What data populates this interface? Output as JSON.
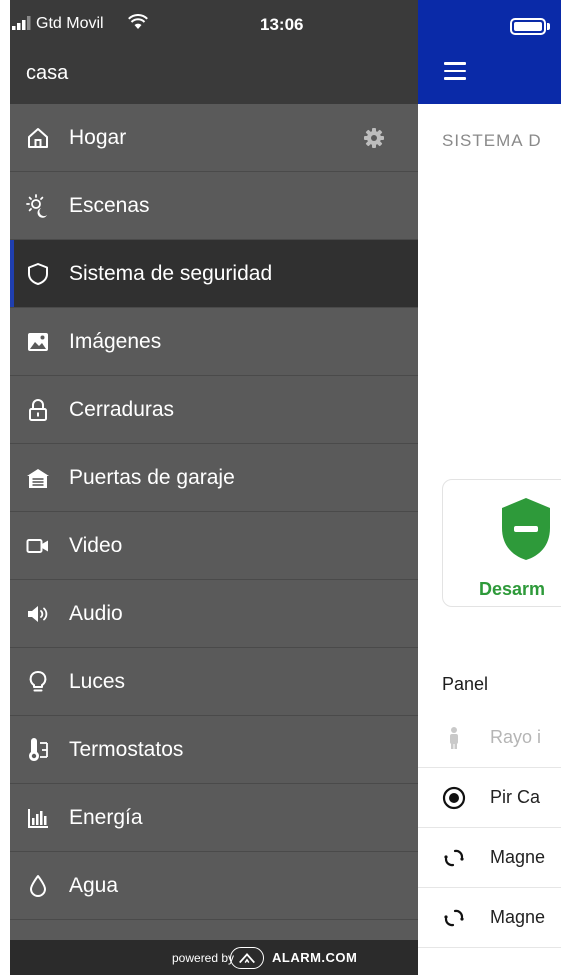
{
  "status_bar": {
    "carrier": "Gtd Movil",
    "time": "13:06",
    "icons": [
      "signal-icon",
      "wifi-icon",
      "battery-icon"
    ]
  },
  "drawer": {
    "location": "casa",
    "items": [
      {
        "label": "Hogar",
        "icon": "home-icon"
      },
      {
        "label": "Escenas",
        "icon": "scenes-icon"
      },
      {
        "label": "Sistema de seguridad",
        "icon": "shield-icon",
        "active": true
      },
      {
        "label": "Imágenes",
        "icon": "image-icon"
      },
      {
        "label": "Cerraduras",
        "icon": "lock-icon"
      },
      {
        "label": "Puertas de garaje",
        "icon": "garage-icon"
      },
      {
        "label": "Video",
        "icon": "video-icon"
      },
      {
        "label": "Audio",
        "icon": "speaker-icon"
      },
      {
        "label": "Luces",
        "icon": "bulb-icon"
      },
      {
        "label": "Termostatos",
        "icon": "thermostat-icon"
      },
      {
        "label": "Energía",
        "icon": "energy-icon"
      },
      {
        "label": "Agua",
        "icon": "water-drop-icon"
      }
    ],
    "settings_icon": "gear-icon",
    "footer": {
      "powered_by": "powered by",
      "brand": "ALARM.COM"
    }
  },
  "main": {
    "section_title": "SISTEMA D",
    "status_label": "Desarm",
    "panel_title": "Panel",
    "sensors": [
      {
        "label": "Rayo i",
        "icon": "person-icon",
        "muted": true
      },
      {
        "label": "Pir Ca",
        "icon": "motion-dot-icon"
      },
      {
        "label": "Magne",
        "icon": "link-icon"
      },
      {
        "label": "Magne",
        "icon": "link-icon"
      }
    ]
  },
  "colors": {
    "header_blue": "#0a2aa8",
    "drawer_bg": "#5a5a5a",
    "drawer_active": "#303030",
    "accent": "#1f3fb0",
    "disarmed_green": "#2e9a3a"
  }
}
